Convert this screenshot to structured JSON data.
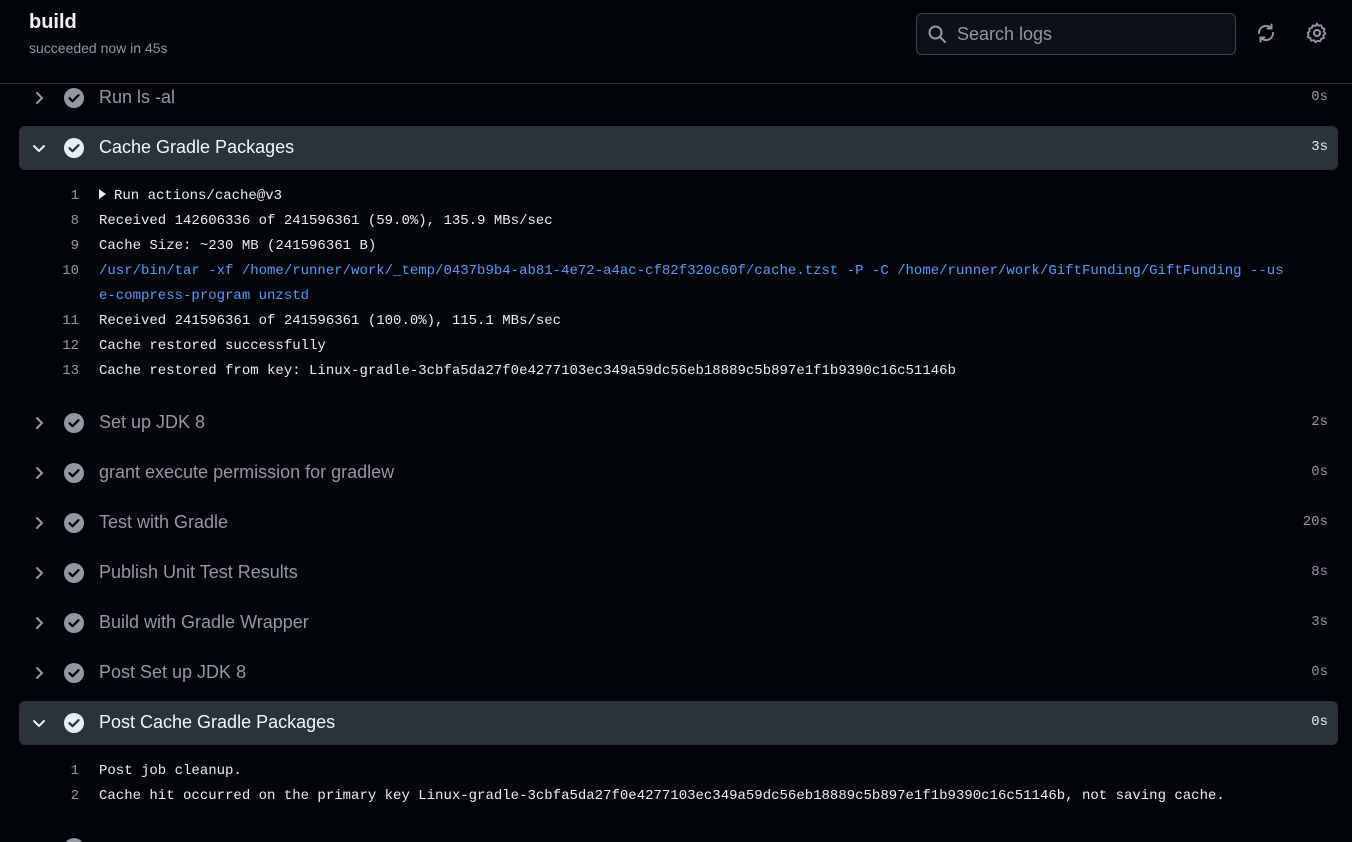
{
  "header": {
    "title": "build",
    "status": "succeeded now in 45s",
    "search_placeholder": "Search logs",
    "refresh_icon": "sync-icon",
    "settings_icon": "gear-icon"
  },
  "colors": {
    "background": "#010409",
    "expanded_row": "#2b323b",
    "muted_text": "#9198a1",
    "link_text": "#539bf5"
  },
  "steps": [
    {
      "name": "Run ls -al",
      "duration": "0s",
      "expanded": false
    },
    {
      "name": "Cache Gradle Packages",
      "duration": "3s",
      "expanded": true,
      "log": [
        {
          "num": "1",
          "text": "Run actions/cache@v3"
        },
        {
          "num": "8",
          "text": "Received 142606336 of 241596361 (59.0%), 135.9 MBs/sec"
        },
        {
          "num": "9",
          "text": "Cache Size: ~230 MB (241596361 B)"
        },
        {
          "num": "10",
          "text": "/usr/bin/tar -xf /home/runner/work/_temp/0437b9b4-ab81-4e72-a4ac-cf82f320c60f/cache.tzst -P -C /home/runner/work/GiftFunding/GiftFunding --use-compress-program unzstd"
        },
        {
          "num": "11",
          "text": "Received 241596361 of 241596361 (100.0%), 115.1 MBs/sec"
        },
        {
          "num": "12",
          "text": "Cache restored successfully"
        },
        {
          "num": "13",
          "text": "Cache restored from key: Linux-gradle-3cbfa5da27f0e4277103ec349a59dc56eb18889c5b897e1f1b9390c16c51146b"
        }
      ]
    },
    {
      "name": "Set up JDK 8",
      "duration": "2s",
      "expanded": false
    },
    {
      "name": "grant execute permission for gradlew",
      "duration": "0s",
      "expanded": false
    },
    {
      "name": "Test with Gradle",
      "duration": "20s",
      "expanded": false
    },
    {
      "name": "Publish Unit Test Results",
      "duration": "8s",
      "expanded": false
    },
    {
      "name": "Build with Gradle Wrapper",
      "duration": "3s",
      "expanded": false
    },
    {
      "name": "Post Set up JDK 8",
      "duration": "0s",
      "expanded": false
    },
    {
      "name": "Post Cache Gradle Packages",
      "duration": "0s",
      "expanded": true,
      "log": [
        {
          "num": "1",
          "text": "Post job cleanup."
        },
        {
          "num": "2",
          "text": "Cache hit occurred on the primary key Linux-gradle-3cbfa5da27f0e4277103ec349a59dc56eb18889c5b897e1f1b9390c16c51146b, not saving cache."
        }
      ]
    }
  ]
}
